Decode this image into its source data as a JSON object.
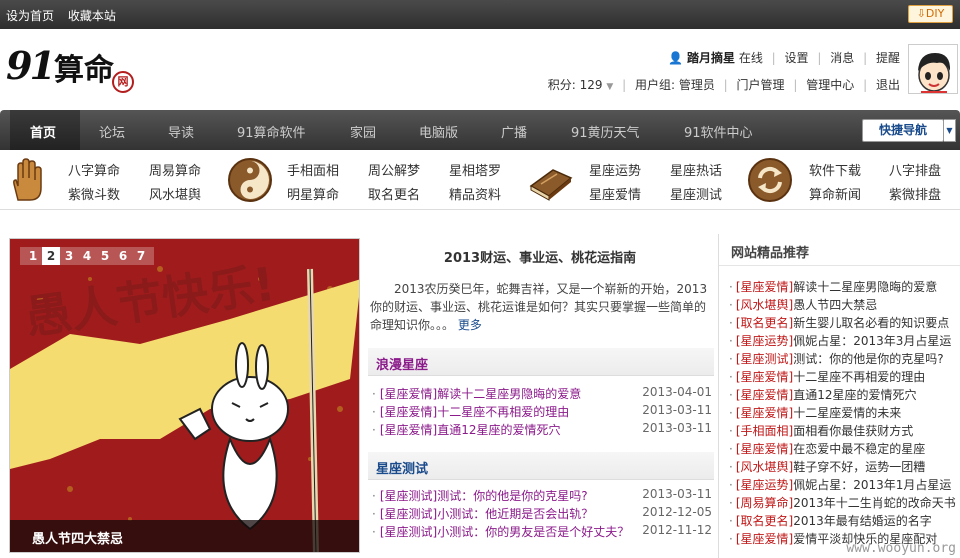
{
  "topbar": {
    "set_home": "设为首页",
    "bookmark": "收藏本站",
    "diy": "DIY"
  },
  "header": {
    "logo_num": "91",
    "logo_text": "算命",
    "logo_seal": "网",
    "user": {
      "name": "踏月摘星",
      "status": "在线",
      "links": [
        "设置",
        "消息",
        "提醒"
      ],
      "points_label": "积分: 129",
      "group_label": "用户组: 管理员",
      "portal": "门户管理",
      "admin": "管理中心",
      "logout": "退出"
    }
  },
  "nav": {
    "items": [
      "首页",
      "论坛",
      "导读",
      "91算命软件",
      "家园",
      "电脑版",
      "广播",
      "91黄历天气",
      "91软件中心"
    ],
    "quick": "快捷导航"
  },
  "categories": {
    "g1": [
      "八字算命",
      "周易算命",
      "紫微斗数",
      "风水堪舆"
    ],
    "g2": [
      "手相面相",
      "周公解梦",
      "星相塔罗",
      "明星算命",
      "取名更名",
      "精品资料"
    ],
    "g3": [
      "星座运势",
      "星座热话",
      "星座爱情",
      "星座测试"
    ],
    "g4": [
      "软件下载",
      "八字排盘",
      "算命新闻",
      "紫微排盘"
    ],
    "icons": [
      "hand-icon",
      "yinyang-icon",
      "book-icon",
      "refresh-icon"
    ]
  },
  "slider": {
    "numbers": [
      "1",
      "2",
      "3",
      "4",
      "5",
      "6",
      "7"
    ],
    "active": "2",
    "banner_text": "愚人节快乐!",
    "caption": "愚人节四大禁忌"
  },
  "main": {
    "title": "2013财运、事业运、桃花运指南",
    "summary": "2013农历癸巳年，蛇舞吉祥，又是一个崭新的开始，2013你的财运、事业运、桃花运谁是如何？其实只要掌握一些简单的命理知识你。。。",
    "more": "更多",
    "sec1": {
      "title": "浪漫星座",
      "rows": [
        {
          "text": "[星座爱情]解读十二星座男隐晦的爱意",
          "date": "2013-04-01"
        },
        {
          "text": "[星座爱情]十二星座不再相爱的理由",
          "date": "2013-03-11"
        },
        {
          "text": "[星座爱情]直通12星座的爱情死穴",
          "date": "2013-03-11"
        }
      ]
    },
    "sec2": {
      "title": "星座测试",
      "rows": [
        {
          "text": "[星座测试]测试：你的他是你的克星吗?",
          "date": "2013-03-11"
        },
        {
          "text": "[星座测试]小测试：他近期是否会出轨？",
          "date": "2012-12-05"
        },
        {
          "text": "[星座测试]小测试：你的男友是否是个好丈夫？",
          "date": "2012-11-12"
        }
      ]
    }
  },
  "recommend": {
    "title": "网站精品推荐",
    "rows": [
      {
        "tag": "[星座爱情]",
        "text": "解读十二星座男隐晦的爱意"
      },
      {
        "tag": "[风水堪舆]",
        "text": "愚人节四大禁忌"
      },
      {
        "tag": "[取名更名]",
        "text": "新生婴儿取名必看的知识要点"
      },
      {
        "tag": "[星座运势]",
        "text": "佩妮占星：2013年3月占星运"
      },
      {
        "tag": "[星座测试]",
        "text": "测试：你的他是你的克星吗?"
      },
      {
        "tag": "[星座爱情]",
        "text": "十二星座不再相爱的理由"
      },
      {
        "tag": "[星座爱情]",
        "text": "直通12星座的爱情死穴"
      },
      {
        "tag": "[星座爱情]",
        "text": "十二星座爱情的未来"
      },
      {
        "tag": "[手相面相]",
        "text": "面相看你最佳获财方式"
      },
      {
        "tag": "[星座爱情]",
        "text": "在恋爱中最不稳定的星座"
      },
      {
        "tag": "[风水堪舆]",
        "text": "鞋子穿不好，运势一团糟"
      },
      {
        "tag": "[星座运势]",
        "text": "佩妮占星：2013年1月占星运"
      },
      {
        "tag": "[周易算命]",
        "text": "2013年十二生肖蛇的改命天书"
      },
      {
        "tag": "[取名更名]",
        "text": "2013年最有结婚运的名字"
      },
      {
        "tag": "[星座爱情]",
        "text": "爱情平淡却快乐的星座配对"
      }
    ]
  },
  "watermark": "www.wooyun.org"
}
